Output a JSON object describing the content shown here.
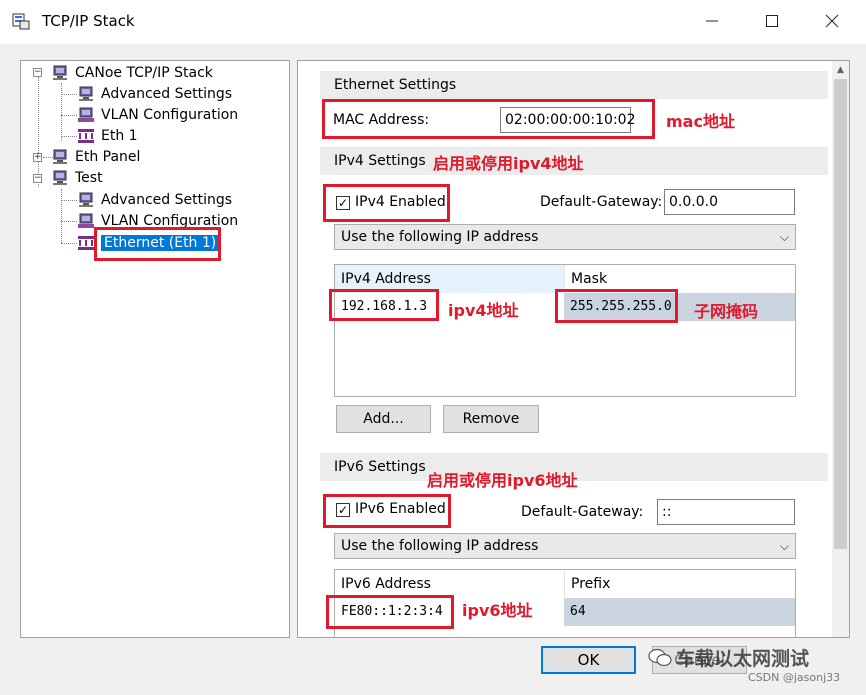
{
  "window": {
    "title": "TCP/IP Stack"
  },
  "tree": {
    "items": [
      {
        "label": "CANoe TCP/IP Stack"
      },
      {
        "label": "Advanced Settings"
      },
      {
        "label": "VLAN Configuration"
      },
      {
        "label": "Eth 1"
      },
      {
        "label": "Eth Panel"
      },
      {
        "label": "Test"
      },
      {
        "label": "Advanced Settings"
      },
      {
        "label": "VLAN Configuration"
      },
      {
        "label": "Ethernet (Eth 1)"
      }
    ]
  },
  "ethernet": {
    "header": "Ethernet Settings",
    "mac_label": "MAC Address:",
    "mac_value": "02:00:00:00:10:02"
  },
  "ipv4": {
    "header": "IPv4 Settings",
    "enabled_label": "IPv4 Enabled",
    "enabled": true,
    "gateway_label": "Default-Gateway:",
    "gateway_value": "0.0.0.0",
    "mode": "Use the following IP address",
    "col_address": "IPv4 Address",
    "col_mask": "Mask",
    "address": "192.168.1.3",
    "mask": "255.255.255.0",
    "add_label": "Add...",
    "remove_label": "Remove"
  },
  "ipv6": {
    "header": "IPv6 Settings",
    "enabled_label": "IPv6 Enabled",
    "enabled": true,
    "gateway_label": "Default-Gateway:",
    "gateway_value": "::",
    "mode": "Use the following IP address",
    "col_address": "IPv6 Address",
    "col_prefix": "Prefix",
    "address": "FE80::1:2:3:4",
    "prefix": "64"
  },
  "annotations": {
    "mac": "mac地址",
    "ipv4_toggle": "启用或停用ipv4地址",
    "ipv4_addr": "ipv4地址",
    "mask": "子网掩码",
    "ipv6_toggle": "启用或停用ipv6地址",
    "ipv6_addr": "ipv6地址"
  },
  "footer": {
    "ok_label": "OK",
    "cancel_label": "Cancel",
    "watermark": "车载以太网测试",
    "credit": "CSDN @jasonj33"
  },
  "colors": {
    "annotation_red": "#e0192d",
    "selection_blue": "#0078d7"
  }
}
